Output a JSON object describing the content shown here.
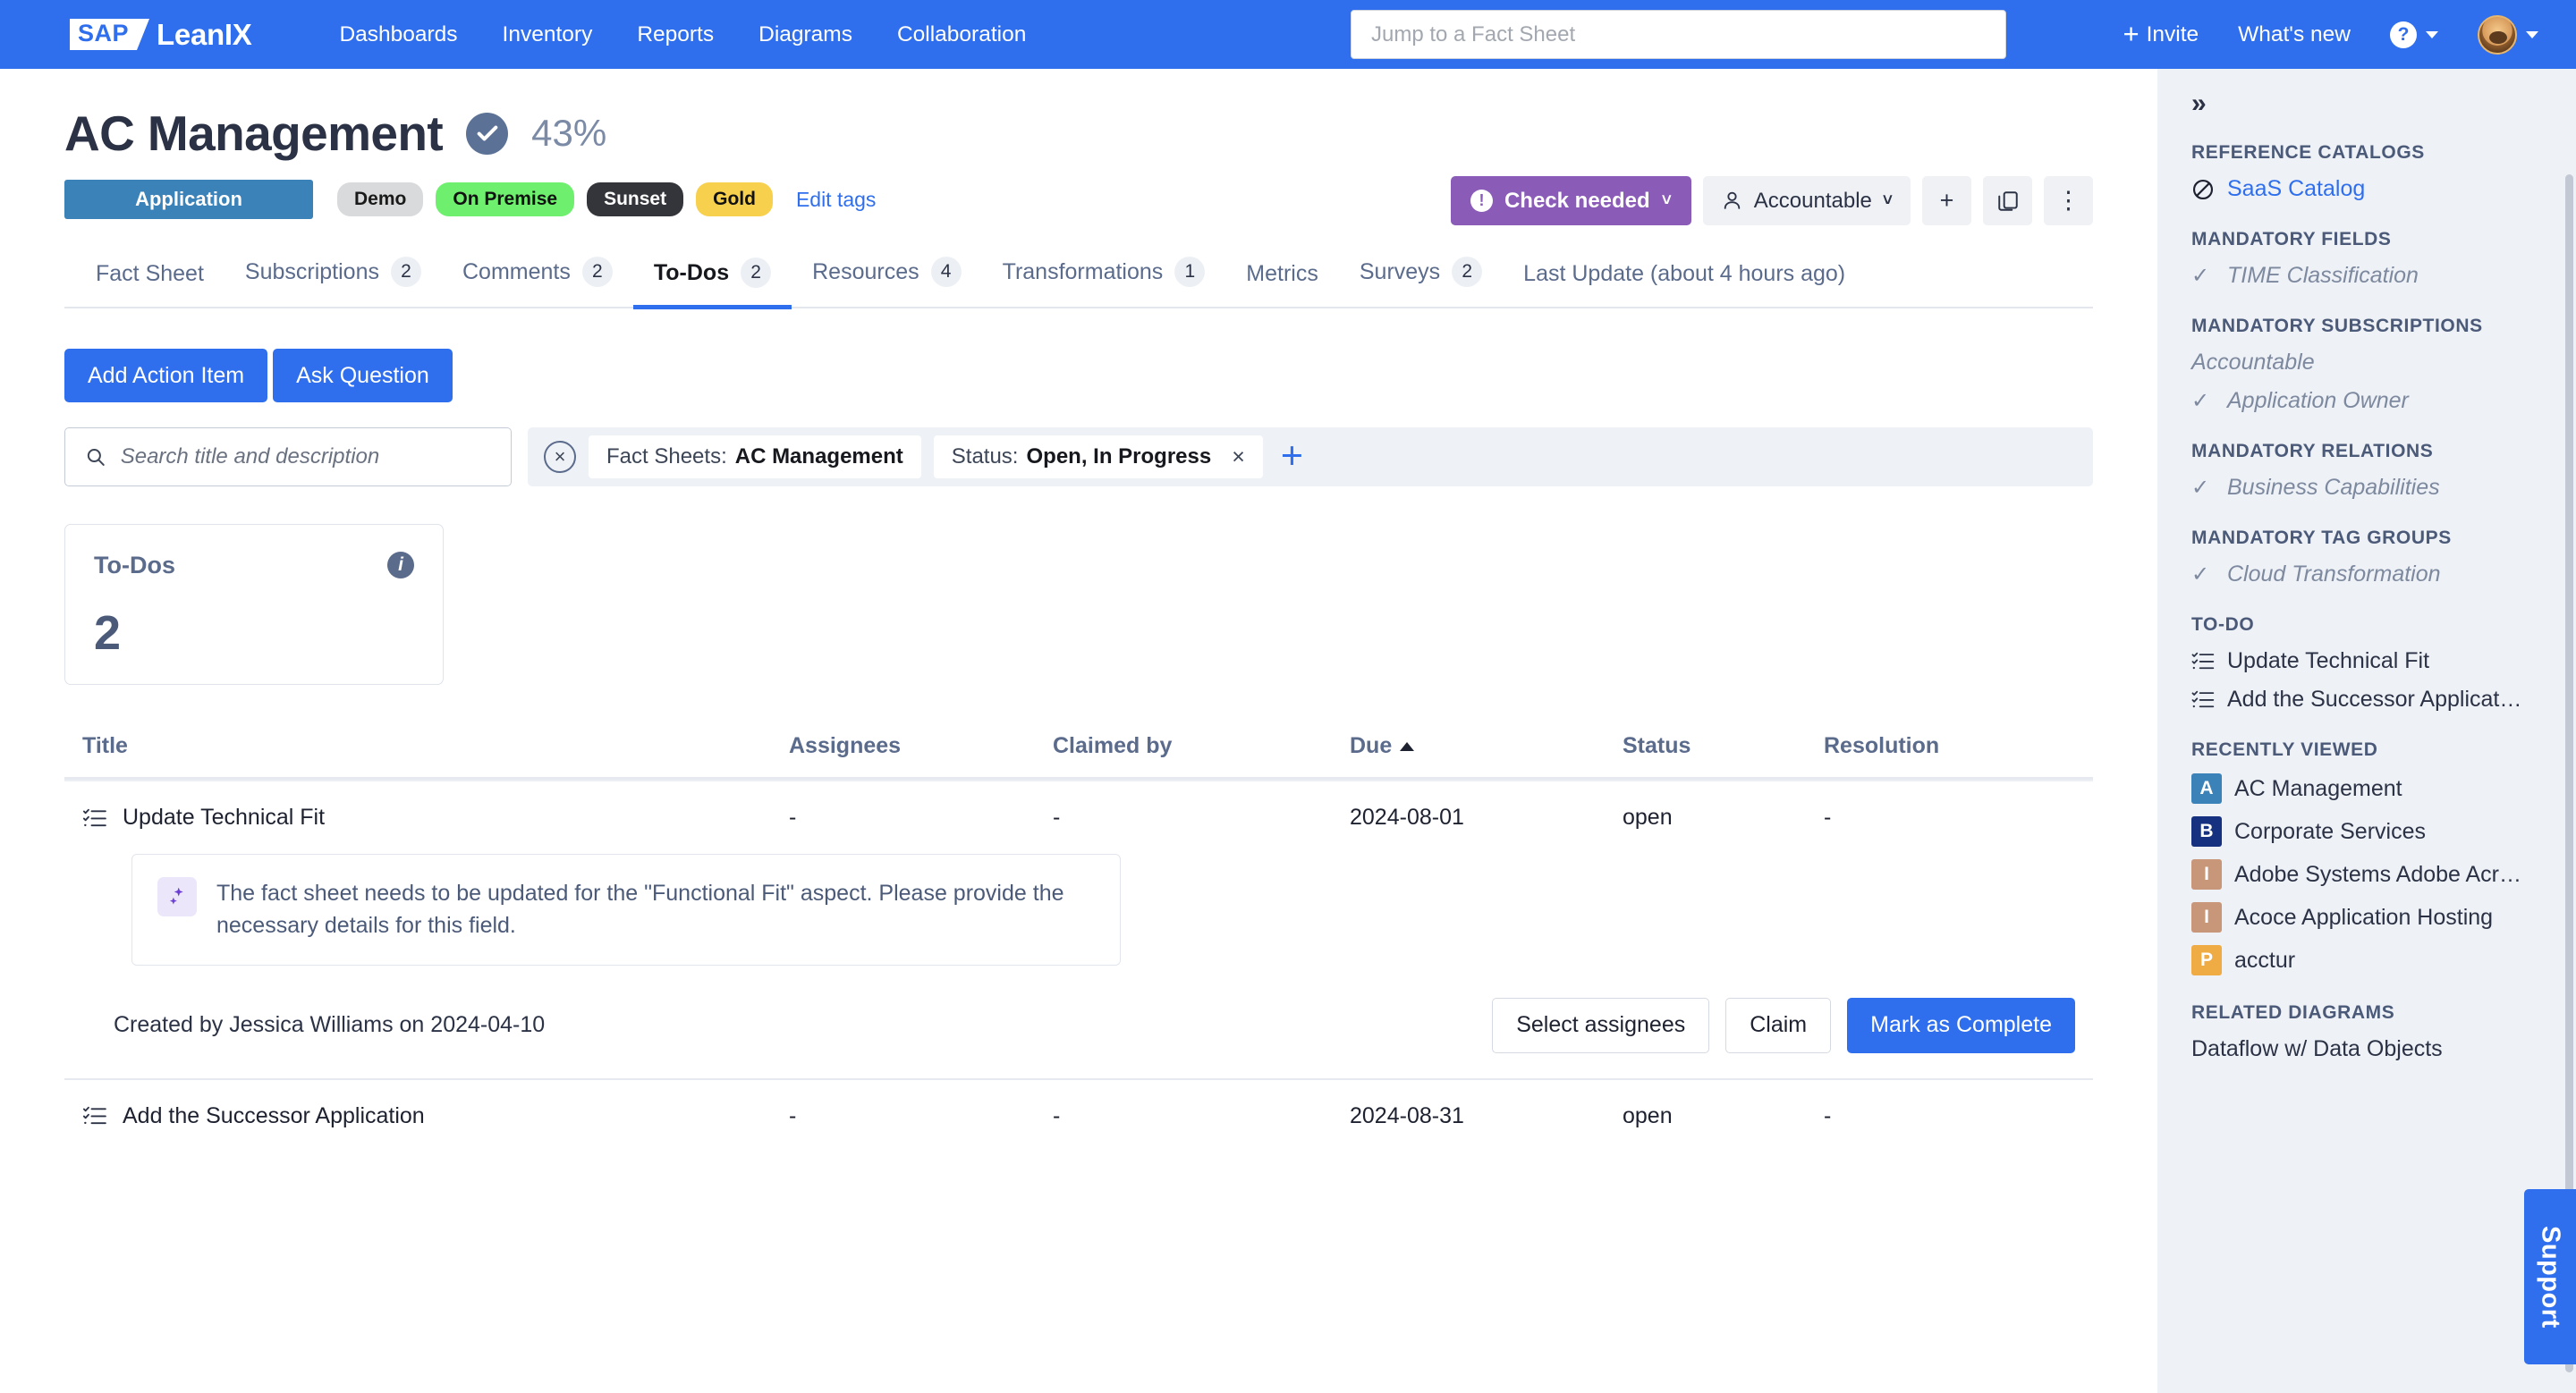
{
  "topnav": {
    "logo_sap": "SAP",
    "logo_name": "LeanIX",
    "links": [
      "Dashboards",
      "Inventory",
      "Reports",
      "Diagrams",
      "Collaboration"
    ],
    "search_placeholder": "Jump to a Fact Sheet",
    "search_value": "",
    "invite_label": "Invite",
    "whats_new_label": "What's new",
    "help_glyph": "?",
    "accent_color": "#2f6fed"
  },
  "page": {
    "title": "AC Management",
    "completion": "43%",
    "type_tag": "Application",
    "tags": [
      {
        "label": "Demo",
        "class": "tag-demo"
      },
      {
        "label": "On Premise",
        "class": "tag-onprem"
      },
      {
        "label": "Sunset",
        "class": "tag-sunset"
      },
      {
        "label": "Gold",
        "class": "tag-gold"
      }
    ],
    "edit_tags": "Edit tags",
    "quality_seal_color": "#5b7296"
  },
  "head_actions": {
    "check_needed": "Check needed",
    "accountable": "Accountable",
    "add_glyph": "+",
    "copy_glyph": "❐",
    "more_glyph": "⋮",
    "check_color": "#8a5cb8"
  },
  "tabs": [
    {
      "label": "Fact Sheet",
      "badge": "",
      "active": false
    },
    {
      "label": "Subscriptions",
      "badge": "2",
      "active": false
    },
    {
      "label": "Comments",
      "badge": "2",
      "active": false
    },
    {
      "label": "To-Dos",
      "badge": "2",
      "active": true
    },
    {
      "label": "Resources",
      "badge": "4",
      "active": false
    },
    {
      "label": "Transformations",
      "badge": "1",
      "active": false
    },
    {
      "label": "Metrics",
      "badge": "",
      "active": false
    },
    {
      "label": "Surveys",
      "badge": "2",
      "active": false
    },
    {
      "label": "Last Update (about 4 hours ago)",
      "badge": "",
      "active": false
    }
  ],
  "toolbar": {
    "add_action_item": "Add Action Item",
    "ask_question": "Ask Question"
  },
  "filters": {
    "search_placeholder": "Search title and description",
    "search_value": "",
    "clear_glyph": "×",
    "chips": [
      {
        "label": "Fact Sheets:",
        "value": "AC Management",
        "removable": false
      },
      {
        "label": "Status:",
        "value": "Open,  In Progress",
        "removable": true
      }
    ],
    "add_filter_glyph": "+"
  },
  "kpi": {
    "label": "To-Dos",
    "value": "2",
    "info_glyph": "i"
  },
  "table": {
    "columns": [
      "Title",
      "Assignees",
      "Claimed by",
      "Due",
      "Status",
      "Resolution"
    ],
    "sorted_column": "Due",
    "sort_direction": "asc",
    "rows": [
      {
        "title": "Update Technical Fit",
        "assignees": "-",
        "claimed_by": "-",
        "due": "2024-08-01",
        "status": "open",
        "resolution": "-",
        "expanded": true,
        "ai_message": "The fact sheet needs to be updated for the \"Functional Fit\" aspect. Please provide the necessary details for this field.",
        "created_by": "Created by Jessica Williams on 2024-04-10",
        "buttons": {
          "select_assignees": "Select assignees",
          "claim": "Claim",
          "mark_complete": "Mark as Complete"
        }
      },
      {
        "title": "Add the Successor Application",
        "assignees": "-",
        "claimed_by": "-",
        "due": "2024-08-31",
        "status": "open",
        "resolution": "-",
        "expanded": false
      }
    ]
  },
  "sidebar": {
    "expand_glyph": "»",
    "reference_catalogs": {
      "heading": "REFERENCE CATALOGS",
      "items": [
        {
          "label": "SaaS Catalog",
          "icon": "ban-icon"
        }
      ]
    },
    "mandatory_fields": {
      "heading": "MANDATORY FIELDS",
      "items": [
        {
          "label": "TIME Classification",
          "checked": true
        }
      ]
    },
    "mandatory_subscriptions": {
      "heading": "MANDATORY SUBSCRIPTIONS",
      "items": [
        {
          "label": "Accountable",
          "checked": false
        },
        {
          "label": "Application Owner",
          "checked": true
        }
      ]
    },
    "mandatory_relations": {
      "heading": "MANDATORY RELATIONS",
      "items": [
        {
          "label": "Business Capabilities",
          "checked": true
        }
      ]
    },
    "mandatory_tag_groups": {
      "heading": "MANDATORY TAG GROUPS",
      "items": [
        {
          "label": "Cloud Transformation",
          "checked": true
        }
      ]
    },
    "todo": {
      "heading": "TO-DO",
      "items": [
        {
          "label": "Update Technical Fit"
        },
        {
          "label": "Add the Successor Applicat…"
        }
      ]
    },
    "recently_viewed": {
      "heading": "RECENTLY VIEWED",
      "items": [
        {
          "letter": "A",
          "label": "AC Management",
          "color": "#3b82b8"
        },
        {
          "letter": "B",
          "label": "Corporate Services",
          "color": "#16317f"
        },
        {
          "letter": "I",
          "label": "Adobe Systems Adobe Acr…",
          "color": "#c89679"
        },
        {
          "letter": "I",
          "label": "Acoce Application Hosting",
          "color": "#c89679"
        },
        {
          "letter": "P",
          "label": "acctur",
          "color": "#f0ac44"
        }
      ]
    },
    "related_diagrams": {
      "heading": "RELATED DIAGRAMS",
      "items": [
        {
          "label": "Dataflow w/ Data Objects"
        }
      ]
    },
    "support_label": "Support"
  }
}
